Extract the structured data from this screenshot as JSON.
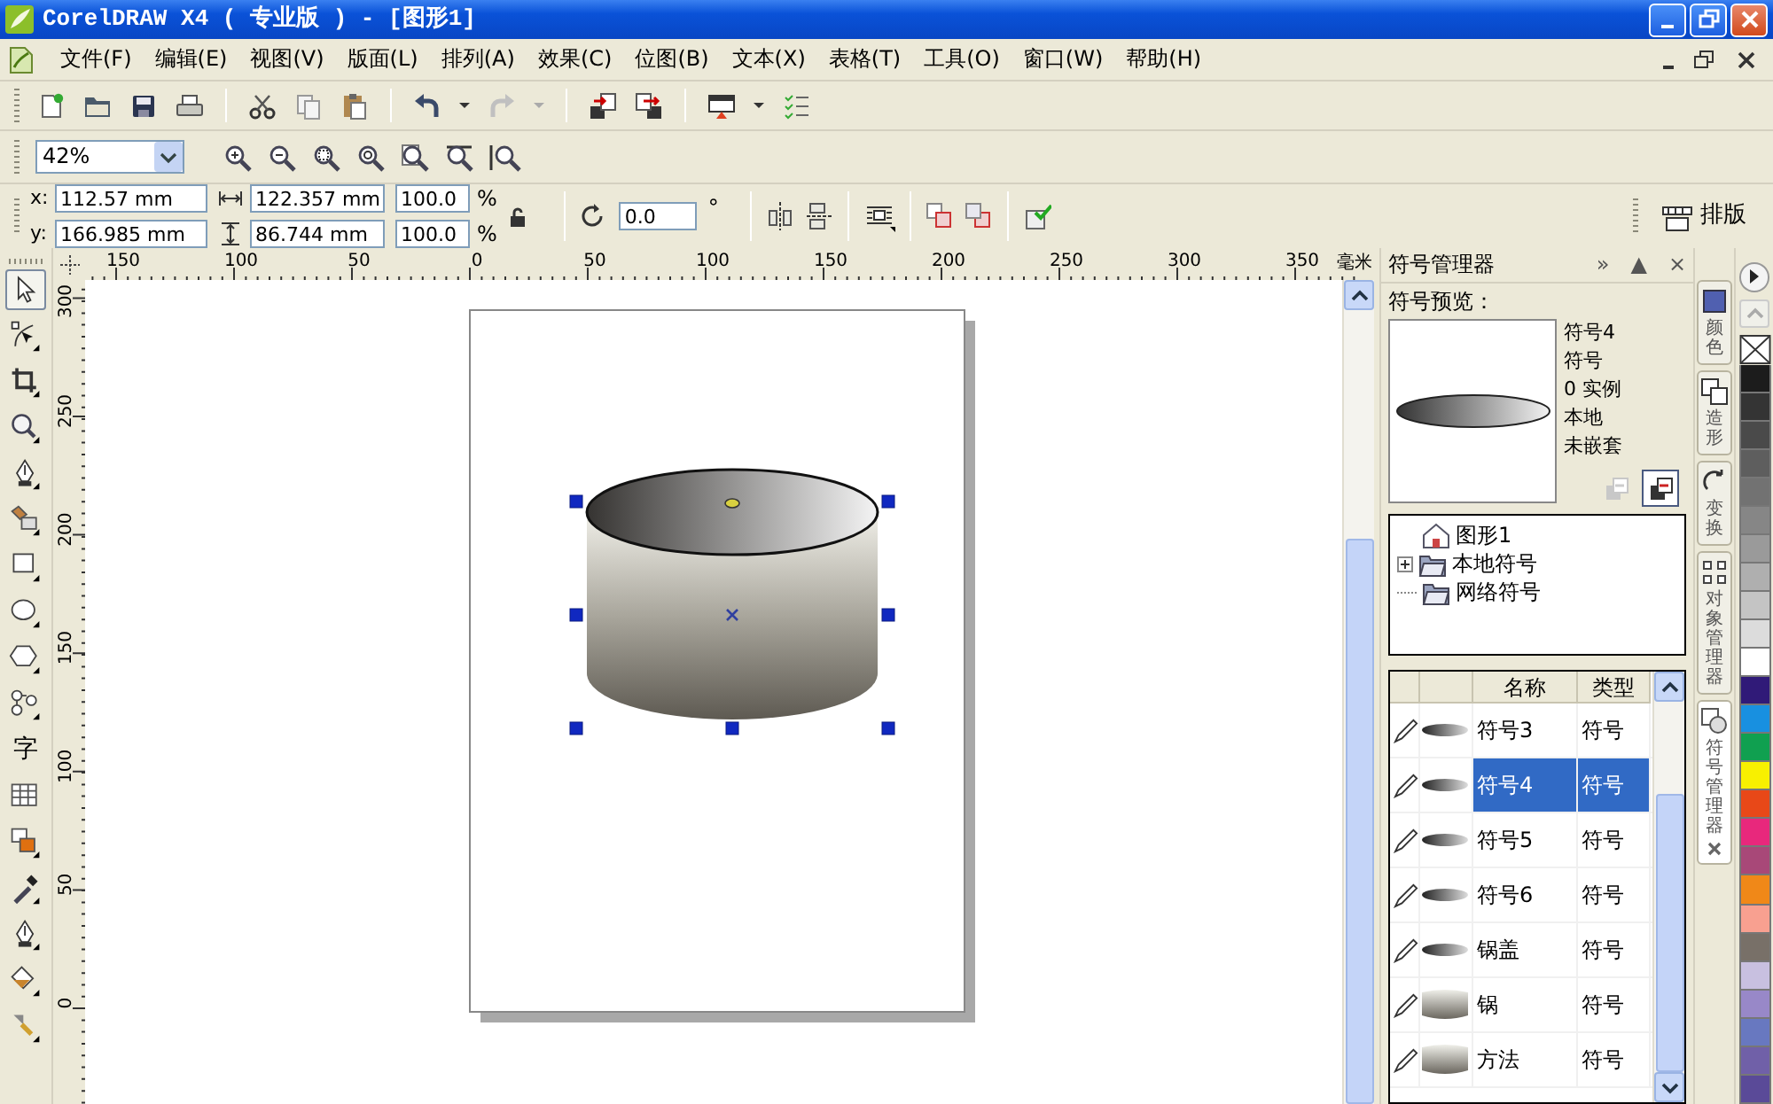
{
  "window": {
    "title": "CorelDRAW X4 ( 专业版 ) - [图形1]"
  },
  "menu": [
    "文件(F)",
    "编辑(E)",
    "视图(V)",
    "版面(L)",
    "排列(A)",
    "效果(C)",
    "位图(B)",
    "文本(X)",
    "表格(T)",
    "工具(O)",
    "窗口(W)",
    "帮助(H)"
  ],
  "zoom": {
    "value": "42%"
  },
  "property_bar": {
    "x_label": "x:",
    "x_value": "112.57 mm",
    "y_label": "y:",
    "y_value": "166.985 mm",
    "width_value": "122.357 mm",
    "height_value": "86.744 mm",
    "scale": [
      {
        "value": "100.0",
        "unit": "%"
      },
      {
        "value": "100.0",
        "unit": "%"
      }
    ],
    "rotation": {
      "value": "0.0",
      "unit": "°"
    },
    "layout_button": "排版"
  },
  "toolbox": [
    {
      "kind": "icon",
      "selected": true
    },
    {
      "kind": "icon",
      "selected": false
    },
    {
      "kind": "icon",
      "selected": false
    },
    {
      "kind": "icon",
      "selected": false
    },
    {
      "kind": "icon",
      "selected": false
    },
    {
      "kind": "icon",
      "selected": false
    },
    {
      "kind": "icon",
      "selected": false
    },
    {
      "kind": "icon",
      "selected": false
    },
    {
      "kind": "icon",
      "selected": false
    },
    {
      "kind": "icon",
      "selected": false
    },
    {
      "kind": "text",
      "label": "字",
      "selected": false
    },
    {
      "kind": "icon",
      "selected": false
    },
    {
      "kind": "icon",
      "selected": false
    },
    {
      "kind": "icon",
      "selected": false
    },
    {
      "kind": "icon",
      "selected": false
    },
    {
      "kind": "icon",
      "selected": false
    },
    {
      "kind": "icon",
      "selected": false
    }
  ],
  "rulers": {
    "horizontal_labels": [
      "150",
      "100",
      "50",
      "0",
      "50",
      "100",
      "150",
      "200",
      "250",
      "300",
      "350"
    ],
    "unit": "毫米",
    "vertical_labels": [
      "300",
      "250",
      "200",
      "150",
      "100",
      "50",
      "0"
    ]
  },
  "docker": {
    "title": "符号管理器",
    "header_buttons": [
      "»",
      "▲",
      "×"
    ],
    "preview_label": "符号预览：",
    "info": [
      "符号4",
      "符号",
      "0 实例",
      "本地",
      "未嵌套"
    ],
    "preview_buttons": [
      {
        "disabled": true
      },
      {
        "disabled": false
      }
    ],
    "tree": [
      {
        "label": "图形1"
      },
      {
        "label": "本地符号",
        "expanded": false
      },
      {
        "label": "网络符号"
      }
    ],
    "table": {
      "columns": [
        "名称",
        "类型"
      ],
      "rows": [
        {
          "name": "符号3",
          "type": "符号",
          "kind": "ellipse",
          "selected": false
        },
        {
          "name": "符号4",
          "type": "符号",
          "kind": "ellipse",
          "selected": true
        },
        {
          "name": "符号5",
          "type": "符号",
          "kind": "ellipse",
          "selected": false
        },
        {
          "name": "符号6",
          "type": "符号",
          "kind": "ellipse",
          "selected": false
        },
        {
          "name": "锅盖",
          "type": "符号",
          "kind": "ellipse",
          "selected": false
        },
        {
          "name": "锅",
          "type": "符号",
          "kind": "cylinder",
          "selected": false
        },
        {
          "name": "方法",
          "type": "符号",
          "kind": "cylinder",
          "selected": false
        }
      ]
    }
  },
  "side_tabs": [
    {
      "label": "颜色",
      "selected": false
    },
    {
      "label": "造形",
      "selected": false
    },
    {
      "label": "变换",
      "selected": false
    },
    {
      "label": "对象管理器",
      "selected": false
    },
    {
      "label": "符号管理器",
      "selected": true
    }
  ],
  "palette": [
    {
      "color": "#1c1c1c"
    },
    {
      "color": "#343434"
    },
    {
      "color": "#4a4a4a"
    },
    {
      "color": "#5e5e5e"
    },
    {
      "color": "#727272"
    },
    {
      "color": "#868686"
    },
    {
      "color": "#9a9a9a"
    },
    {
      "color": "#afafaf"
    },
    {
      "color": "#c4c4c4"
    },
    {
      "color": "#dcdcdc"
    },
    {
      "color": "#ffffff"
    },
    {
      "color": "#301a78"
    },
    {
      "color": "#1890e0"
    },
    {
      "color": "#10a050"
    },
    {
      "color": "#f8f000"
    },
    {
      "color": "#e84818"
    },
    {
      "color": "#e8287c"
    },
    {
      "color": "#a84878"
    },
    {
      "color": "#f08818"
    },
    {
      "color": "#f8a090"
    },
    {
      "color": "#787068"
    },
    {
      "color": "#c8c0e0"
    },
    {
      "color": "#9888c8"
    },
    {
      "color": "#6878c0"
    },
    {
      "color": "#7060a8"
    },
    {
      "color": "#5a4a98"
    }
  ]
}
